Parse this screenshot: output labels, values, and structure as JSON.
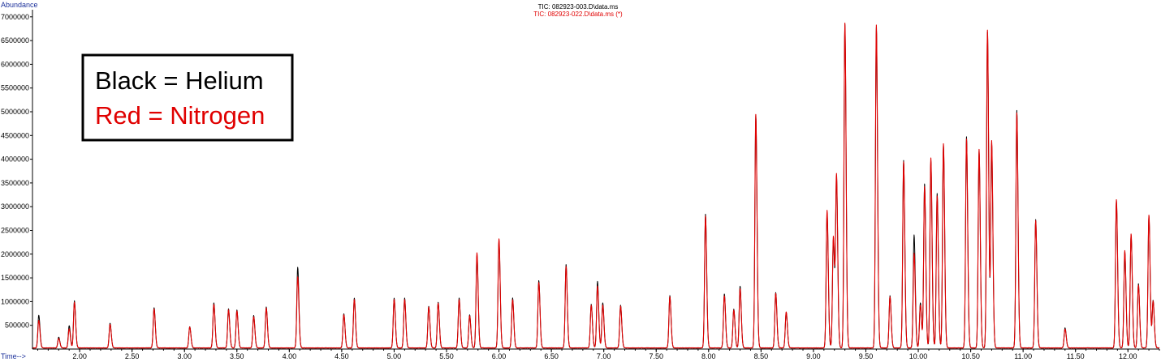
{
  "header": {
    "trace1_label": "TIC: 082923-003.D\\data.ms",
    "trace2_label": "TIC: 082923-022.D\\data.ms (*)"
  },
  "axes": {
    "y_title": "Abundance",
    "x_title": "Time-->"
  },
  "legend": {
    "line1": "Black = Helium",
    "line2": "Red = Nitrogen"
  },
  "colors": {
    "helium": "#000000",
    "nitrogen": "#e00000",
    "axis_title": "#1a2f9a"
  },
  "chart_data": {
    "type": "line",
    "title": "",
    "xlabel": "Time-->",
    "ylabel": "Abundance",
    "xlim": [
      1.55,
      12.3
    ],
    "ylim": [
      0,
      7150000
    ],
    "x_ticks": [
      "2.00",
      "2.50",
      "3.00",
      "3.50",
      "4.00",
      "4.50",
      "5.00",
      "5.50",
      "6.00",
      "6.50",
      "7.00",
      "7.50",
      "8.00",
      "8.50",
      "9.00",
      "9.50",
      "10.00",
      "10.50",
      "11.00",
      "11.50",
      "12.00"
    ],
    "y_ticks": [
      "500000",
      "1000000",
      "1500000",
      "2000000",
      "2500000",
      "3000000",
      "3500000",
      "4000000",
      "4500000",
      "5000000",
      "5500000",
      "6000000",
      "6500000",
      "7000000"
    ],
    "legend_placement": "top-left",
    "series": [
      {
        "name": "TIC: 082923-003.D\\data.ms",
        "color": "#000000",
        "peaks": [
          [
            1.61,
            690000
          ],
          [
            1.8,
            230000
          ],
          [
            1.9,
            470000
          ],
          [
            1.95,
            990000
          ],
          [
            2.29,
            520000
          ],
          [
            2.71,
            850000
          ],
          [
            3.05,
            450000
          ],
          [
            3.28,
            950000
          ],
          [
            3.42,
            820000
          ],
          [
            3.5,
            800000
          ],
          [
            3.66,
            680000
          ],
          [
            3.78,
            860000
          ],
          [
            4.08,
            1700000
          ],
          [
            4.52,
            720000
          ],
          [
            4.62,
            1050000
          ],
          [
            5.0,
            1050000
          ],
          [
            5.1,
            1050000
          ],
          [
            5.33,
            880000
          ],
          [
            5.42,
            960000
          ],
          [
            5.62,
            1050000
          ],
          [
            5.72,
            700000
          ],
          [
            5.79,
            1950000
          ],
          [
            6.0,
            2250000
          ],
          [
            6.13,
            1050000
          ],
          [
            6.38,
            1420000
          ],
          [
            6.64,
            1760000
          ],
          [
            6.88,
            920000
          ],
          [
            6.94,
            1400000
          ],
          [
            6.99,
            950000
          ],
          [
            7.16,
            900000
          ],
          [
            7.63,
            1100000
          ],
          [
            7.97,
            2820000
          ],
          [
            8.15,
            1140000
          ],
          [
            8.24,
            820000
          ],
          [
            8.3,
            1300000
          ],
          [
            8.45,
            4900000
          ],
          [
            8.64,
            1170000
          ],
          [
            8.74,
            750000
          ],
          [
            9.13,
            2830000
          ],
          [
            9.19,
            2280000
          ],
          [
            9.22,
            3550000
          ],
          [
            9.3,
            6820000
          ],
          [
            9.6,
            6750000
          ],
          [
            9.73,
            1100000
          ],
          [
            9.86,
            3950000
          ],
          [
            9.96,
            2380000
          ],
          [
            10.02,
            950000
          ],
          [
            10.06,
            3450000
          ],
          [
            10.12,
            3950000
          ],
          [
            10.18,
            3250000
          ],
          [
            10.24,
            4280000
          ],
          [
            10.46,
            4450000
          ],
          [
            10.58,
            4150000
          ],
          [
            10.66,
            6650000
          ],
          [
            10.7,
            4300000
          ],
          [
            10.94,
            5000000
          ],
          [
            11.12,
            2700000
          ],
          [
            11.4,
            420000
          ],
          [
            11.89,
            3100000
          ],
          [
            11.97,
            2020000
          ],
          [
            12.03,
            2380000
          ],
          [
            12.1,
            1350000
          ],
          [
            12.2,
            2780000
          ],
          [
            12.24,
            1000000
          ]
        ]
      },
      {
        "name": "TIC: 082923-022.D\\data.ms (*)",
        "color": "#e00000",
        "peaks": [
          [
            1.61,
            580000
          ],
          [
            1.8,
            200000
          ],
          [
            1.9,
            400000
          ],
          [
            1.95,
            960000
          ],
          [
            2.29,
            500000
          ],
          [
            2.71,
            820000
          ],
          [
            3.05,
            440000
          ],
          [
            3.28,
            920000
          ],
          [
            3.42,
            800000
          ],
          [
            3.5,
            780000
          ],
          [
            3.66,
            660000
          ],
          [
            3.78,
            840000
          ],
          [
            4.08,
            1500000
          ],
          [
            4.52,
            700000
          ],
          [
            4.62,
            1020000
          ],
          [
            5.0,
            1020000
          ],
          [
            5.1,
            1020000
          ],
          [
            5.33,
            860000
          ],
          [
            5.42,
            940000
          ],
          [
            5.62,
            1020000
          ],
          [
            5.72,
            680000
          ],
          [
            5.79,
            2000000
          ],
          [
            6.0,
            2300000
          ],
          [
            6.13,
            1020000
          ],
          [
            6.38,
            1380000
          ],
          [
            6.64,
            1720000
          ],
          [
            6.88,
            900000
          ],
          [
            6.94,
            1300000
          ],
          [
            6.99,
            900000
          ],
          [
            7.16,
            880000
          ],
          [
            7.63,
            1080000
          ],
          [
            7.97,
            2780000
          ],
          [
            8.15,
            1100000
          ],
          [
            8.24,
            800000
          ],
          [
            8.3,
            1250000
          ],
          [
            8.45,
            4920000
          ],
          [
            8.64,
            1150000
          ],
          [
            8.74,
            760000
          ],
          [
            9.13,
            2900000
          ],
          [
            9.19,
            2350000
          ],
          [
            9.22,
            3600000
          ],
          [
            9.3,
            6850000
          ],
          [
            9.6,
            6800000
          ],
          [
            9.73,
            1080000
          ],
          [
            9.86,
            3920000
          ],
          [
            9.96,
            2000000
          ],
          [
            10.02,
            900000
          ],
          [
            10.06,
            3400000
          ],
          [
            10.12,
            4000000
          ],
          [
            10.18,
            3200000
          ],
          [
            10.24,
            4300000
          ],
          [
            10.46,
            4400000
          ],
          [
            10.58,
            4180000
          ],
          [
            10.66,
            6700000
          ],
          [
            10.7,
            4350000
          ],
          [
            10.94,
            4950000
          ],
          [
            11.12,
            2680000
          ],
          [
            11.4,
            400000
          ],
          [
            11.89,
            3120000
          ],
          [
            11.97,
            2050000
          ],
          [
            12.03,
            2400000
          ],
          [
            12.1,
            1320000
          ],
          [
            12.2,
            2800000
          ],
          [
            12.24,
            980000
          ]
        ]
      }
    ]
  }
}
